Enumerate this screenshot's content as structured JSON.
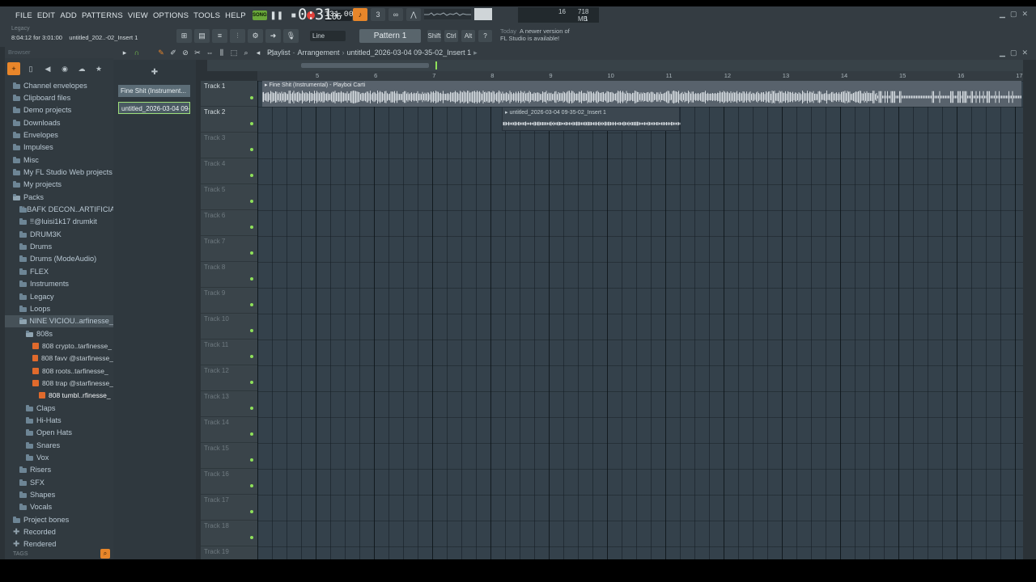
{
  "menu": [
    "FILE",
    "EDIT",
    "ADD",
    "PATTERNS",
    "VIEW",
    "OPTIONS",
    "TOOLS",
    "HELP"
  ],
  "transport": {
    "mode": "SONG",
    "tempo": "131.000",
    "time_main": "0:31",
    "time_sub": "06"
  },
  "monitor": {
    "voices": "16",
    "memory": "718 MB",
    "cpu_count": "1"
  },
  "hint": {
    "line1": "Legacy",
    "line2": "8:04:12 for 3:01:00",
    "line3": "untitled_202..-02_Insert 1"
  },
  "snap": "Line",
  "pattern": "Pattern 1",
  "modifiers": [
    "Shift",
    "Ctrl",
    "Alt"
  ],
  "update": {
    "today": "Today",
    "text_line1": "A newer version of",
    "text_line2": "FL Studio is available!"
  },
  "browser": {
    "title": "Browser",
    "tags_label": "TAGS",
    "items": [
      {
        "label": "Channel envelopes",
        "type": "folder",
        "indent": 0
      },
      {
        "label": "Clipboard files",
        "type": "folder",
        "indent": 0
      },
      {
        "label": "Demo projects",
        "type": "folder",
        "indent": 0
      },
      {
        "label": "Downloads",
        "type": "folder",
        "indent": 0
      },
      {
        "label": "Envelopes",
        "type": "folder",
        "indent": 0
      },
      {
        "label": "Impulses",
        "type": "folder",
        "indent": 0
      },
      {
        "label": "Misc",
        "type": "folder",
        "indent": 0
      },
      {
        "label": "My FL Studio Web projects",
        "type": "folder",
        "indent": 0
      },
      {
        "label": "My projects",
        "type": "folder",
        "indent": 0
      },
      {
        "label": "Packs",
        "type": "folder-open",
        "indent": 0
      },
      {
        "label": "! BAFK DECON..ARTIFICIAL",
        "type": "folder",
        "indent": 1
      },
      {
        "label": "!!@luisi1k17 drumkit",
        "type": "folder",
        "indent": 1
      },
      {
        "label": "DRUM3K",
        "type": "folder",
        "indent": 1
      },
      {
        "label": "Drums",
        "type": "folder",
        "indent": 1
      },
      {
        "label": "Drums (ModeAudio)",
        "type": "folder",
        "indent": 1
      },
      {
        "label": "FLEX",
        "type": "folder",
        "indent": 1
      },
      {
        "label": "Instruments",
        "type": "folder",
        "indent": 1
      },
      {
        "label": "Legacy",
        "type": "folder",
        "indent": 1
      },
      {
        "label": "Loops",
        "type": "folder",
        "indent": 1
      },
      {
        "label": "NINE VICIOU..arfinesse_",
        "type": "folder-open",
        "indent": 1,
        "selected": true
      },
      {
        "label": "808s",
        "type": "folder-open",
        "indent": 2
      },
      {
        "label": "808 crypto..tarfinesse_",
        "type": "file",
        "indent": 3
      },
      {
        "label": "808 favv @starfinesse_",
        "type": "file",
        "indent": 3
      },
      {
        "label": "808 roots..tarfinesse_",
        "type": "file",
        "indent": 3
      },
      {
        "label": "808 trap @starfinesse_",
        "type": "file",
        "indent": 3
      },
      {
        "label": "808 tumbl..rfinesse_",
        "type": "file",
        "indent": 4,
        "active": true
      },
      {
        "label": "Claps",
        "type": "folder",
        "indent": 2
      },
      {
        "label": "Hi-Hats",
        "type": "folder",
        "indent": 2
      },
      {
        "label": "Open Hats",
        "type": "folder",
        "indent": 2
      },
      {
        "label": "Snares",
        "type": "folder",
        "indent": 2
      },
      {
        "label": "Vox",
        "type": "folder",
        "indent": 2
      },
      {
        "label": "Risers",
        "type": "folder",
        "indent": 1
      },
      {
        "label": "SFX",
        "type": "folder",
        "indent": 1
      },
      {
        "label": "Shapes",
        "type": "folder",
        "indent": 1
      },
      {
        "label": "Vocals",
        "type": "folder",
        "indent": 1
      },
      {
        "label": "Project bones",
        "type": "folder",
        "indent": 0
      },
      {
        "label": "Recorded",
        "type": "plus",
        "indent": 0
      },
      {
        "label": "Rendered",
        "type": "plus",
        "indent": 0
      }
    ]
  },
  "picker": {
    "items": [
      {
        "label": "Fine Shit (Instrument..."
      },
      {
        "label": "untitled_2026-03-04 09-..."
      }
    ]
  },
  "playlist": {
    "window": "Playlist",
    "view": "Arrangement",
    "clip_name": "untitled_2026-03-04 09-35-02_Insert 1",
    "ruler": [
      "5",
      "6",
      "7",
      "8",
      "9",
      "10",
      "11",
      "12",
      "13",
      "14",
      "15",
      "16",
      "17"
    ],
    "tracks": [
      "Track 1",
      "Track 2",
      "Track 3",
      "Track 4",
      "Track 5",
      "Track 6",
      "Track 7",
      "Track 8",
      "Track 9",
      "Track 10",
      "Track 11",
      "Track 12",
      "Track 13",
      "Track 14",
      "Track 15",
      "Track 16",
      "Track 17",
      "Track 18",
      "Track 19"
    ],
    "clips": [
      {
        "title": "Fine Shit (Instrumental) - Playboi Carti"
      },
      {
        "title": "untitled_2026-03-04 09-35-02_Insert 1"
      }
    ]
  },
  "colors": {
    "accent": "#e8862a",
    "led": "#8ee05a",
    "record": "#e0413b"
  }
}
